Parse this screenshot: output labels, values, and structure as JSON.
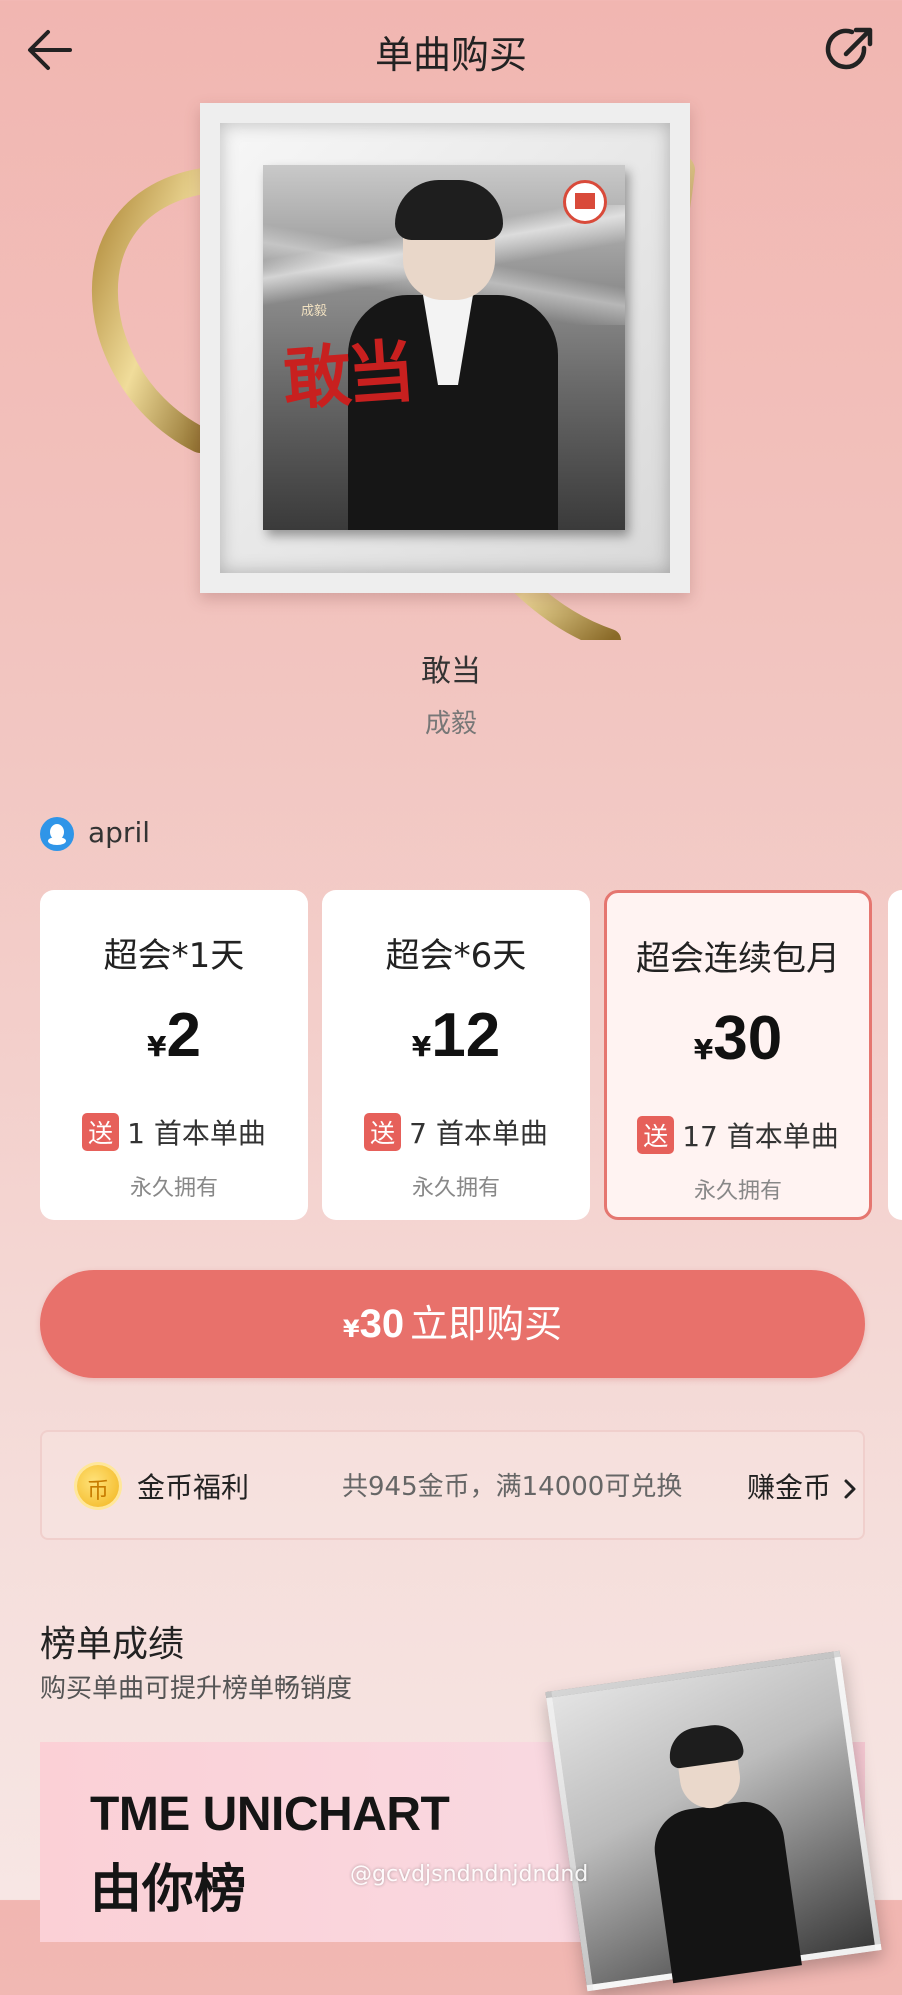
{
  "header": {
    "title": "单曲购买"
  },
  "song": {
    "title": "敢当",
    "artist": "成毅",
    "cover_title": "敢当",
    "cover_artist": "成毅"
  },
  "account": {
    "name": "april"
  },
  "plans": [
    {
      "name": "超会*1天",
      "currency": "¥",
      "price": "2",
      "gift_tag": "送",
      "gift_text": "1 首本单曲",
      "ownership": "永久拥有",
      "selected": false
    },
    {
      "name": "超会*6天",
      "currency": "¥",
      "price": "12",
      "gift_tag": "送",
      "gift_text": "7 首本单曲",
      "ownership": "永久拥有",
      "selected": false
    },
    {
      "name": "超会连续包月",
      "currency": "¥",
      "price": "30",
      "gift_tag": "送",
      "gift_text": "17 首本单曲",
      "ownership": "永久拥有",
      "selected": true
    }
  ],
  "buy_button": {
    "currency": "¥",
    "amount": "30",
    "label": "立即购买"
  },
  "coins": {
    "icon_glyph": "币",
    "label": "金币福利",
    "info": "共945金币，满14000可兑换",
    "link": "赚金币"
  },
  "chart": {
    "title": "榜单成绩",
    "subtitle": "购买单曲可提升榜单畅销度",
    "banner_title": "TME UNICHART",
    "banner_subtitle": "由你榜"
  },
  "watermark": "@gcvdjsndndnjdndnd",
  "colors": {
    "accent": "#e8716b",
    "selected_border": "#e57670",
    "gift_tag": "#e6605a",
    "coin": "#f2b51c",
    "account_icon": "#2f95e8"
  },
  "icons": {
    "back": "arrow-left-icon",
    "share": "share-icon",
    "account": "qq-account-icon",
    "coin": "coin-icon",
    "earn": "chevron-right-icon"
  }
}
